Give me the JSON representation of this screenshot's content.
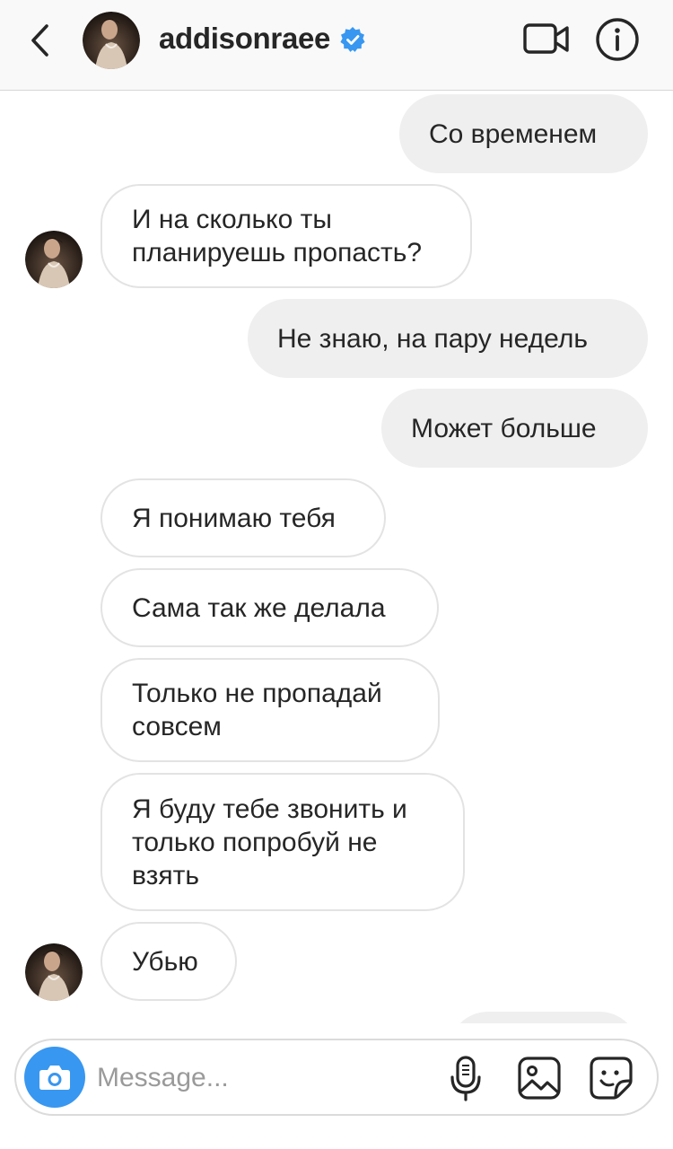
{
  "header": {
    "username": "addisonraee"
  },
  "messages": [
    {
      "sender": "me",
      "text": "Со временем"
    },
    {
      "sender": "them",
      "text": "И на сколько ты\nпланируешь пропасть?"
    },
    {
      "sender": "me",
      "text": "Не знаю, на пару недель"
    },
    {
      "sender": "me",
      "text": "Может больше"
    },
    {
      "sender": "them",
      "text": "Я понимаю тебя"
    },
    {
      "sender": "them",
      "text": "Сама так же делала"
    },
    {
      "sender": "them",
      "text": "Только не пропадай\nсовсем"
    },
    {
      "sender": "them",
      "text": "Я буду тебе звонить и\nтолько попробуй не\nвзять"
    },
    {
      "sender": "them",
      "text": "Убью"
    }
  ],
  "composer": {
    "placeholder": "Message..."
  },
  "colors": {
    "accent": "#3897f0",
    "sent_bubble": "#efefef",
    "received_border": "#e3e3e3",
    "verified_badge": "#3897f0"
  },
  "icons": [
    "back-chevron-icon",
    "verified-badge-icon",
    "video-call-icon",
    "info-icon",
    "camera-icon",
    "microphone-icon",
    "gallery-icon",
    "sticker-icon"
  ]
}
